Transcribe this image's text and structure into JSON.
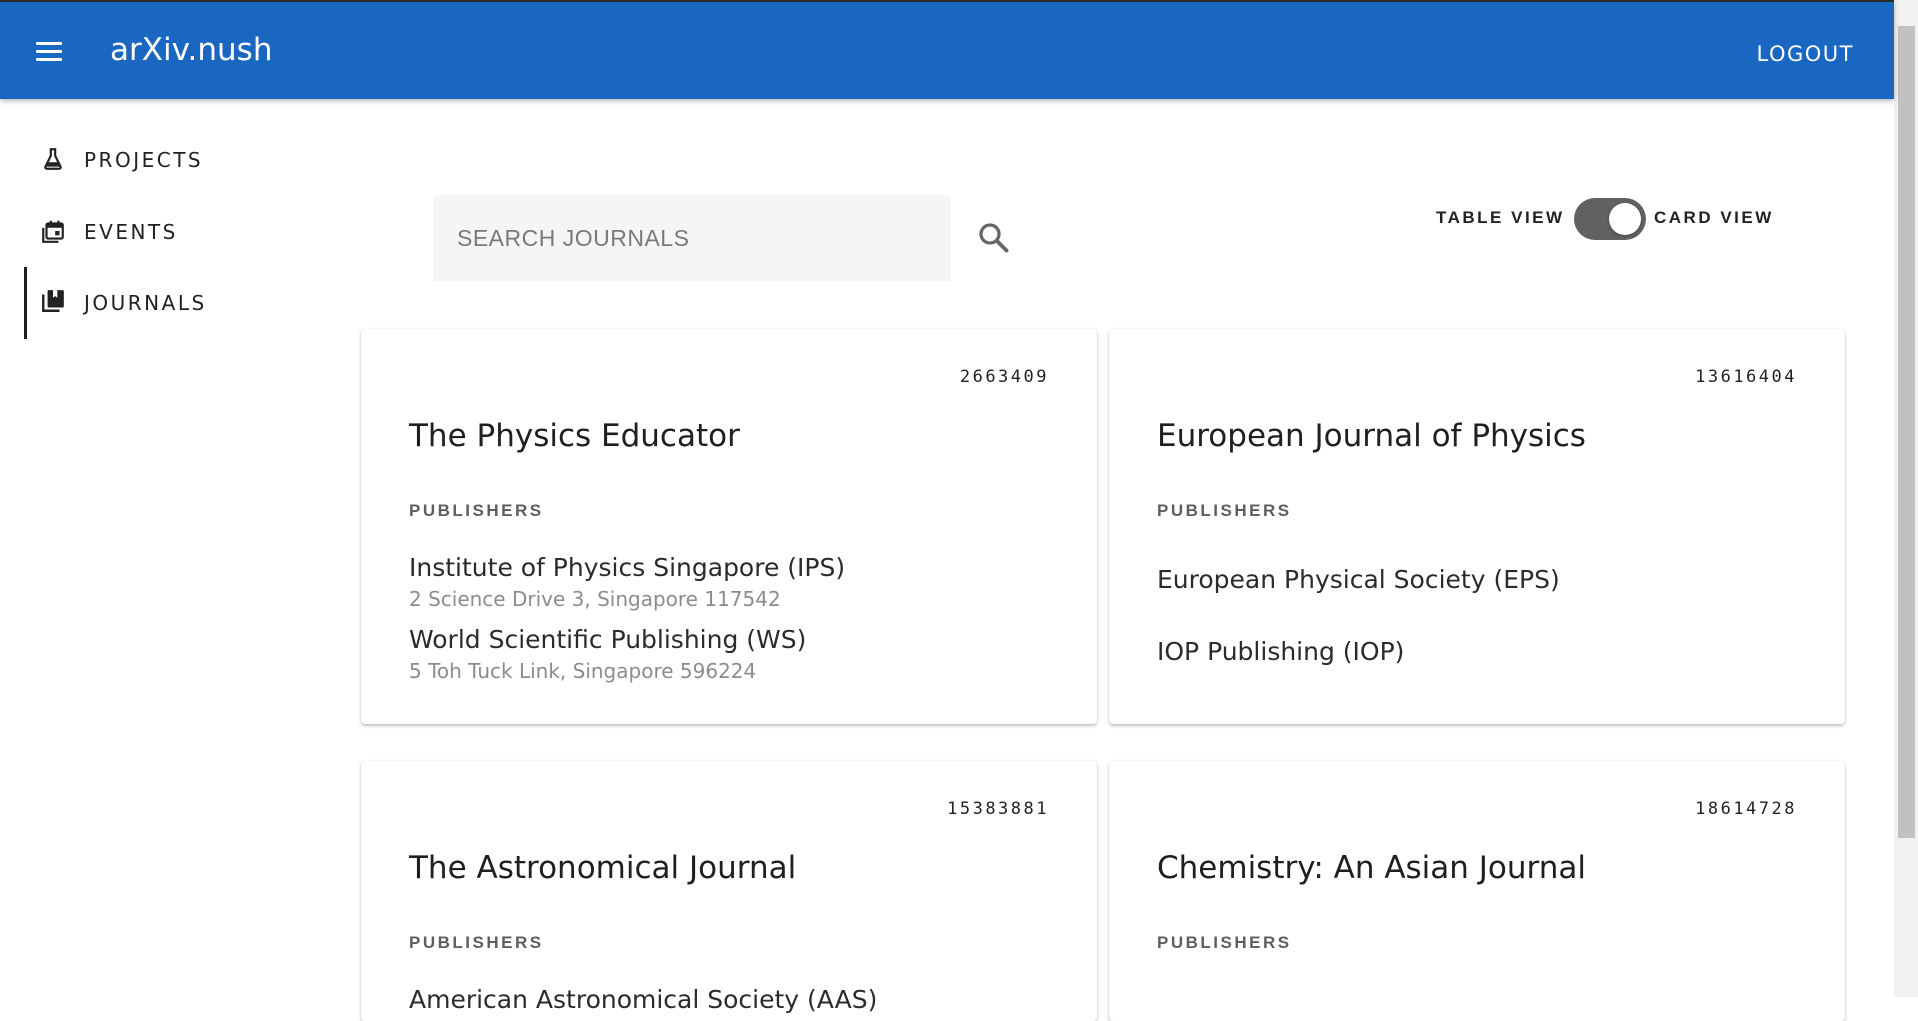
{
  "app": {
    "title": "arXiv.nush",
    "logout_label": "LOGOUT"
  },
  "sidebar": {
    "items": [
      {
        "label": "PROJECTS",
        "icon": "flask-icon"
      },
      {
        "label": "EVENTS",
        "icon": "calendar-icon"
      },
      {
        "label": "JOURNALS",
        "icon": "journal-icon",
        "active": true
      }
    ]
  },
  "search": {
    "placeholder": "SEARCH JOURNALS",
    "value": ""
  },
  "view_toggle": {
    "left_label": "TABLE VIEW",
    "right_label": "CARD VIEW",
    "state": "card"
  },
  "cards": [
    {
      "id": "2663409",
      "title": "The Physics Educator",
      "publishers_heading": "PUBLISHERS",
      "publishers": [
        {
          "name": "Institute of Physics Singapore (IPS)",
          "address": "2 Science Drive 3, Singapore 117542"
        },
        {
          "name": "World Scientific Publishing (WS)",
          "address": "5 Toh Tuck Link, Singapore 596224"
        }
      ]
    },
    {
      "id": "13616404",
      "title": "European Journal of Physics",
      "publishers_heading": "PUBLISHERS",
      "publishers": [
        {
          "name": "European Physical Society (EPS)",
          "address": ""
        },
        {
          "name": "IOP Publishing (IOP)",
          "address": ""
        }
      ]
    },
    {
      "id": "15383881",
      "title": "The Astronomical Journal",
      "publishers_heading": "PUBLISHERS",
      "publishers": [
        {
          "name": "American Astronomical Society (AAS)",
          "address": ""
        }
      ]
    },
    {
      "id": "18614728",
      "title": "Chemistry: An Asian Journal",
      "publishers_heading": "PUBLISHERS",
      "publishers": []
    }
  ],
  "colors": {
    "appbar": "#1a67c2",
    "toggle_track": "#616161"
  }
}
